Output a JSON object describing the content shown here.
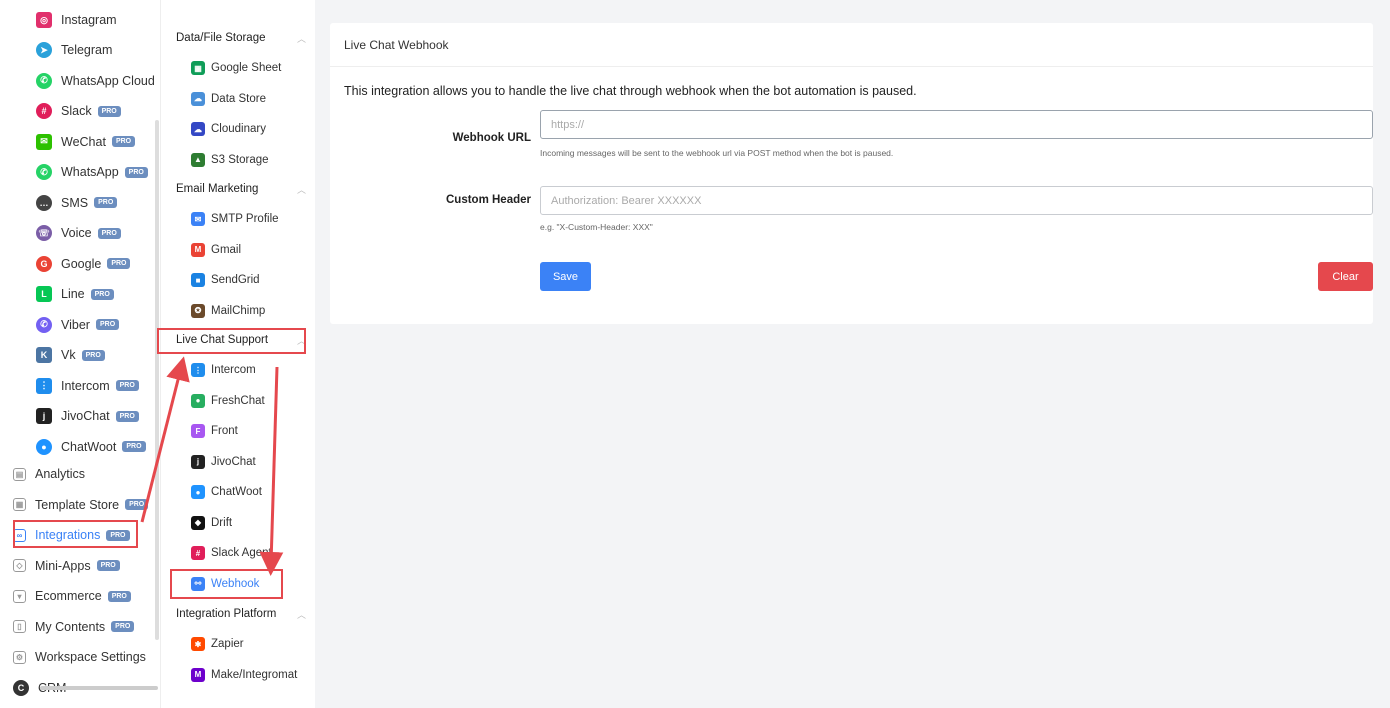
{
  "sidebar": {
    "items": [
      {
        "label": "Instagram",
        "icon": "instagram-icon",
        "color": "#e1306c",
        "pro": false
      },
      {
        "label": "Telegram",
        "icon": "telegram-icon",
        "color": "#2aa1da",
        "pro": false
      },
      {
        "label": "WhatsApp Cloud",
        "icon": "whatsapp-icon",
        "color": "#25d366",
        "pro": true
      },
      {
        "label": "Slack",
        "icon": "slack-icon",
        "color": "#e01e5a",
        "pro": true
      },
      {
        "label": "WeChat",
        "icon": "wechat-icon",
        "color": "#2dc100",
        "pro": true
      },
      {
        "label": "WhatsApp",
        "icon": "whatsapp-icon",
        "color": "#25d366",
        "pro": true
      },
      {
        "label": "SMS",
        "icon": "sms-icon",
        "color": "#444444",
        "pro": true
      },
      {
        "label": "Voice",
        "icon": "voice-icon",
        "color": "#7b5ea7",
        "pro": true
      },
      {
        "label": "Google",
        "icon": "google-icon",
        "color": "#ea4335",
        "pro": true
      },
      {
        "label": "Line",
        "icon": "line-icon",
        "color": "#06c755",
        "pro": true
      },
      {
        "label": "Viber",
        "icon": "viber-icon",
        "color": "#7360f2",
        "pro": true
      },
      {
        "label": "Vk",
        "icon": "vk-icon",
        "color": "#4c75a3",
        "pro": true
      },
      {
        "label": "Intercom",
        "icon": "intercom-icon",
        "color": "#1f8ded",
        "pro": true
      },
      {
        "label": "JivoChat",
        "icon": "jivochat-icon",
        "color": "#222222",
        "pro": true
      },
      {
        "label": "ChatWoot",
        "icon": "chatwoot-icon",
        "color": "#1f93ff",
        "pro": true
      }
    ],
    "top_items": [
      {
        "label": "Analytics",
        "icon": "analytics-icon",
        "pro": false
      },
      {
        "label": "Template Store",
        "icon": "template-store-icon",
        "pro": true
      },
      {
        "label": "Integrations",
        "icon": "integrations-icon",
        "pro": true
      },
      {
        "label": "Mini-Apps",
        "icon": "mini-apps-icon",
        "pro": true
      },
      {
        "label": "Ecommerce",
        "icon": "ecommerce-icon",
        "pro": true
      },
      {
        "label": "My Contents",
        "icon": "my-contents-icon",
        "pro": true
      },
      {
        "label": "Workspace Settings",
        "icon": "workspace-settings-icon",
        "pro": false
      },
      {
        "label": "CRM",
        "icon": "crm-icon",
        "pro": false
      }
    ],
    "pro_label": "PRO"
  },
  "menu": {
    "groups": [
      {
        "label": "Data/File Storage",
        "items": [
          {
            "label": "Google Sheet",
            "icon": "google-sheet-icon",
            "color": "#0f9d58"
          },
          {
            "label": "Data Store",
            "icon": "data-store-icon",
            "color": "#4a90d9"
          },
          {
            "label": "Cloudinary",
            "icon": "cloudinary-icon",
            "color": "#3448c5"
          },
          {
            "label": "S3 Storage",
            "icon": "s3-storage-icon",
            "color": "#2e7d32"
          }
        ]
      },
      {
        "label": "Email Marketing",
        "items": [
          {
            "label": "SMTP Profile",
            "icon": "smtp-profile-icon",
            "color": "#3b82f6"
          },
          {
            "label": "Gmail",
            "icon": "gmail-icon",
            "color": "#ea4335"
          },
          {
            "label": "SendGrid",
            "icon": "sendgrid-icon",
            "color": "#1a82e2"
          },
          {
            "label": "MailChimp",
            "icon": "mailchimp-icon",
            "color": "#6b4a2b"
          }
        ]
      },
      {
        "label": "Live Chat Support",
        "items": [
          {
            "label": "Intercom",
            "icon": "intercom-icon",
            "color": "#1f8ded"
          },
          {
            "label": "FreshChat",
            "icon": "freshchat-icon",
            "color": "#27ae60"
          },
          {
            "label": "Front",
            "icon": "front-icon",
            "color": "#a857f1"
          },
          {
            "label": "JivoChat",
            "icon": "jivochat-icon",
            "color": "#222222"
          },
          {
            "label": "ChatWoot",
            "icon": "chatwoot-icon",
            "color": "#1f93ff"
          },
          {
            "label": "Drift",
            "icon": "drift-icon",
            "color": "#111111"
          },
          {
            "label": "Slack Agent",
            "icon": "slack-icon",
            "color": "#e01e5a"
          },
          {
            "label": "Webhook",
            "icon": "webhook-icon",
            "color": "#3b82f6"
          }
        ]
      },
      {
        "label": "Integration Platform",
        "items": [
          {
            "label": "Zapier",
            "icon": "zapier-icon",
            "color": "#ff4a00"
          },
          {
            "label": "Make/Integromat",
            "icon": "make-icon",
            "color": "#6d00cc"
          }
        ]
      }
    ]
  },
  "main": {
    "title": "Live Chat Webhook",
    "description": "This integration allows you to handle the live chat through webhook when the bot automation is paused.",
    "webhook": {
      "label": "Webhook URL",
      "placeholder": "https://",
      "value": "",
      "help": "Incoming messages will be sent to the webhook url via POST method when the bot is paused."
    },
    "header": {
      "label": "Custom Header",
      "placeholder": "Authorization: Bearer XXXXXX",
      "value": "",
      "help": "e.g. \"X-Custom-Header: XXX\""
    },
    "save_label": "Save",
    "clear_label": "Clear"
  },
  "colors": {
    "accent": "#3b82f6",
    "danger": "#e5484d",
    "annotation": "#e5484d"
  }
}
